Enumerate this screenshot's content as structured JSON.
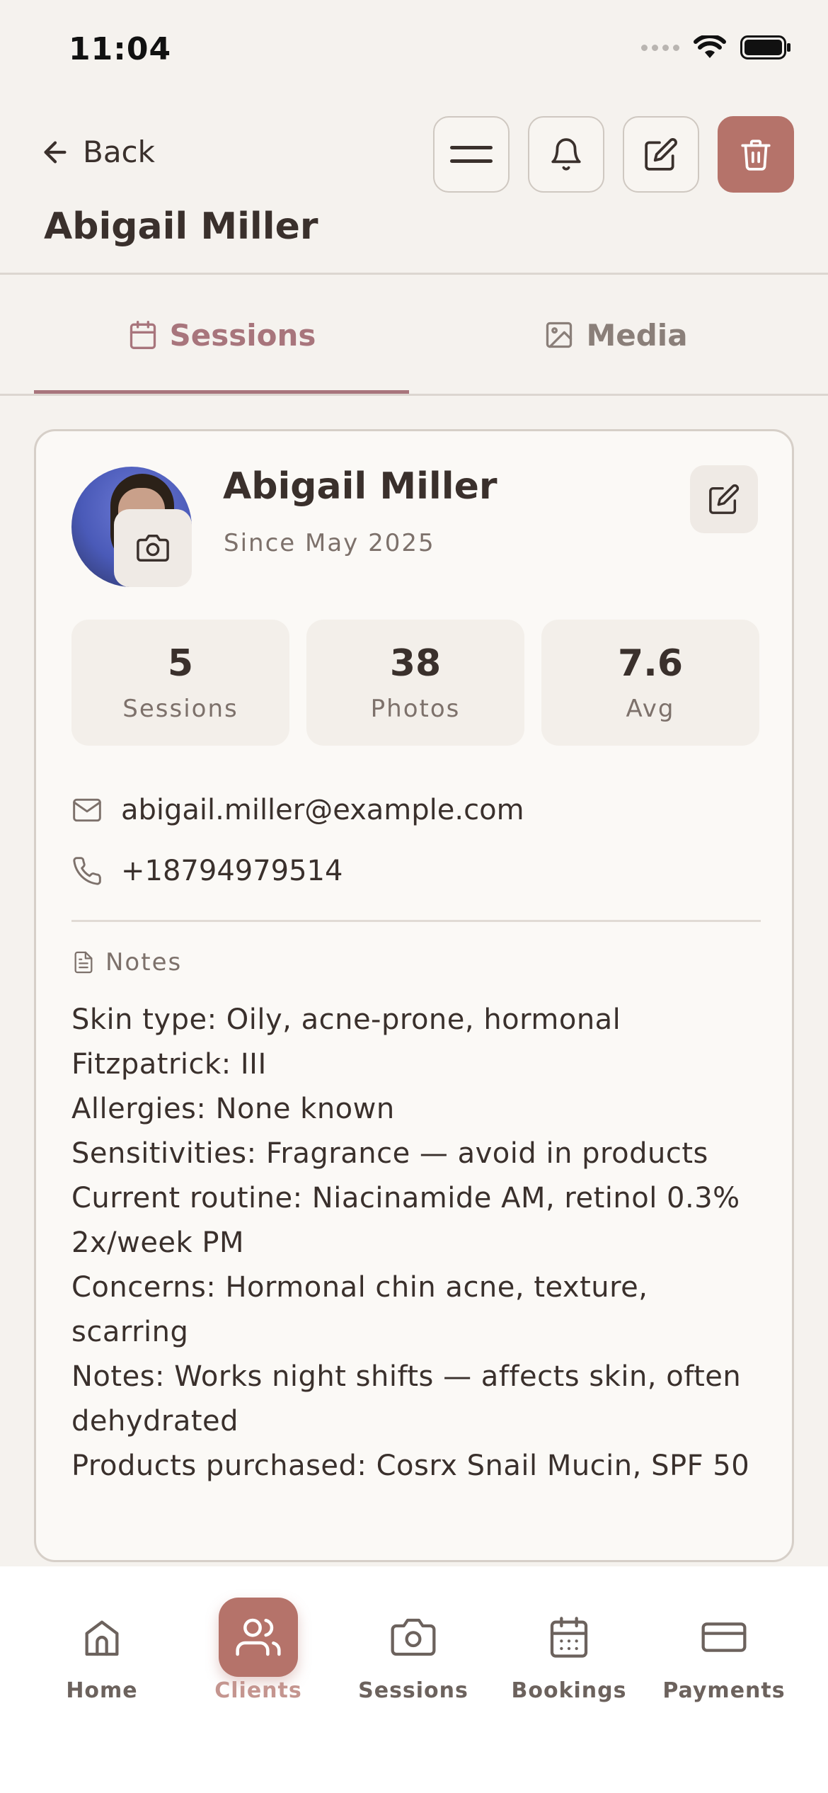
{
  "status_bar": {
    "time": "11:04"
  },
  "header": {
    "back_label": "Back",
    "title": "Abigail Miller"
  },
  "tabs": [
    {
      "label": "Sessions",
      "active": true
    },
    {
      "label": "Media",
      "active": false
    }
  ],
  "client": {
    "name": "Abigail Miller",
    "since": "Since May 2025",
    "stats": [
      {
        "value": "5",
        "label": "Sessions"
      },
      {
        "value": "38",
        "label": "Photos"
      },
      {
        "value": "7.6",
        "label": "Avg"
      }
    ],
    "email": "abigail.miller@example.com",
    "phone": "+18794979514",
    "notes_label": "Notes",
    "notes": "Skin type: Oily, acne-prone, hormonal\nFitzpatrick: III\nAllergies: None known\nSensitivities: Fragrance — avoid in products\nCurrent routine: Niacinamide AM, retinol 0.3% 2x/week PM\nConcerns: Hormonal chin acne, texture, scarring\nNotes: Works night shifts — affects skin, often dehydrated\nProducts purchased: Cosrx Snail Mucin, SPF 50"
  },
  "bottom_nav": [
    {
      "label": "Home",
      "icon": "home-icon",
      "active": false
    },
    {
      "label": "Clients",
      "icon": "users-icon",
      "active": true
    },
    {
      "label": "Sessions",
      "icon": "camera-icon",
      "active": false
    },
    {
      "label": "Bookings",
      "icon": "calendar-icon",
      "active": false
    },
    {
      "label": "Payments",
      "icon": "credit-card-icon",
      "active": false
    }
  ],
  "colors": {
    "accent": "#b5736a",
    "tab_active": "#a8757c",
    "background": "#f5f2ee"
  }
}
